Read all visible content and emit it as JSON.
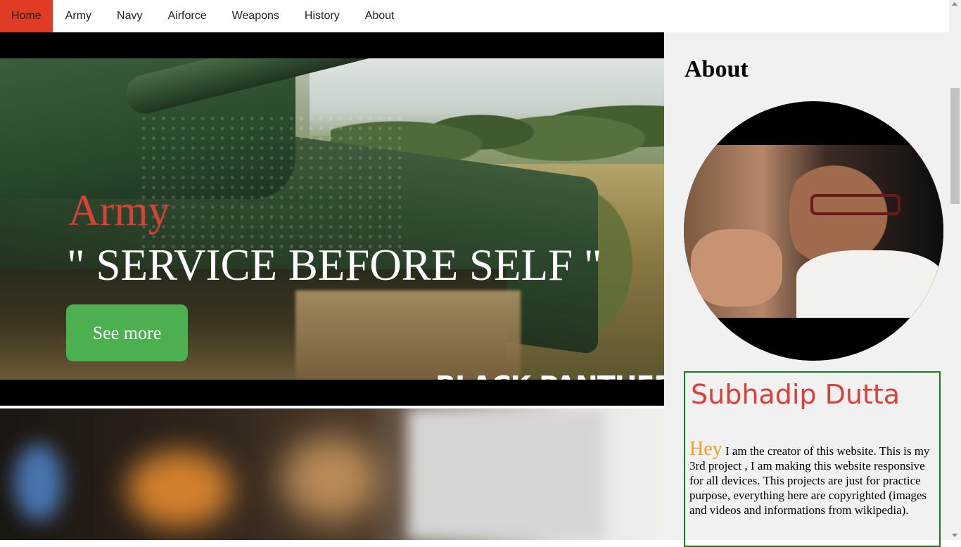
{
  "nav": {
    "items": [
      {
        "label": "Home"
      },
      {
        "label": "Army"
      },
      {
        "label": "Navy"
      },
      {
        "label": "Airforce"
      },
      {
        "label": "Weapons"
      },
      {
        "label": "History"
      },
      {
        "label": "About"
      }
    ],
    "active_index": 0,
    "active_color": "#e03c25"
  },
  "hero": {
    "title": "Army",
    "motto": "\" SERVICE BEFORE SELF \"",
    "button_label": "See more",
    "watermark": "BLACK PANTHER",
    "title_color": "#d6423a",
    "button_color": "#4caf50"
  },
  "sidebar": {
    "title": "About",
    "author_name": "Subhadip Dutta",
    "greeting": "Hey",
    "bio": "I am the creator of this website. This is my 3rd project , I am making this website responsive for all devices. This projects are just for practice purpose, everything here are copyrighted (images and videos and informations from wikipedia).",
    "name_color": "#d6423a",
    "greeting_color": "#f0a020",
    "box_border_color": "#1b7a1b"
  }
}
